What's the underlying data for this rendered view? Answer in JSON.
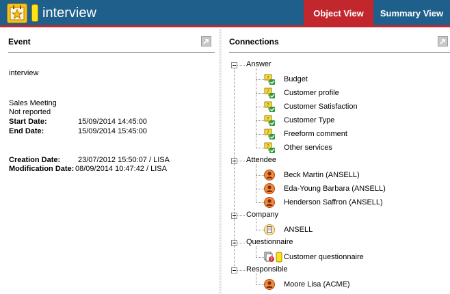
{
  "header": {
    "title": "interview",
    "app_icon": "star-calendar-icon",
    "flag_icon": "yellow-flag-icon",
    "tabs": [
      {
        "label": "Object View",
        "active": true
      },
      {
        "label": "Summary View",
        "active": false
      }
    ],
    "colors": {
      "bar": "#1f5f8b",
      "active_tab": "#c2272d",
      "accent_line": "#c2272d"
    }
  },
  "event_panel": {
    "title": "Event",
    "name": "interview",
    "type": "Sales Meeting",
    "report_status": "Not reported",
    "start_label": "Start Date:",
    "start_value": "15/09/2014 14:45:00",
    "end_label": "End Date:",
    "end_value": "15/09/2014 15:45:00",
    "creation_label": "Creation Date:",
    "creation_value": "23/07/2012 15:50:07 / LISA",
    "modification_label": "Modification Date:",
    "modification_value": "08/09/2014 10:47:42 / LISA"
  },
  "connections_panel": {
    "title": "Connections",
    "groups": [
      {
        "label": "Answer",
        "icon": "answer-check-icon",
        "items": [
          "Budget",
          "Customer profile",
          "Customer Satisfaction",
          "Customer Type",
          "Freeform comment",
          "Other services"
        ]
      },
      {
        "label": "Attendee",
        "icon": "person-icon",
        "items": [
          "Beck Martin (ANSELL)",
          "Eda-Young Barbara (ANSELL)",
          "Henderson Saffron (ANSELL)"
        ]
      },
      {
        "label": "Company",
        "icon": "company-building-icon",
        "items": [
          "ANSELL"
        ]
      },
      {
        "label": "Questionnaire",
        "icon": "questionnaire-icon",
        "items": [
          "Customer questionnaire"
        ]
      },
      {
        "label": "Responsible",
        "icon": "person-icon",
        "items": [
          "Moore Lisa (ACME)"
        ]
      }
    ]
  }
}
